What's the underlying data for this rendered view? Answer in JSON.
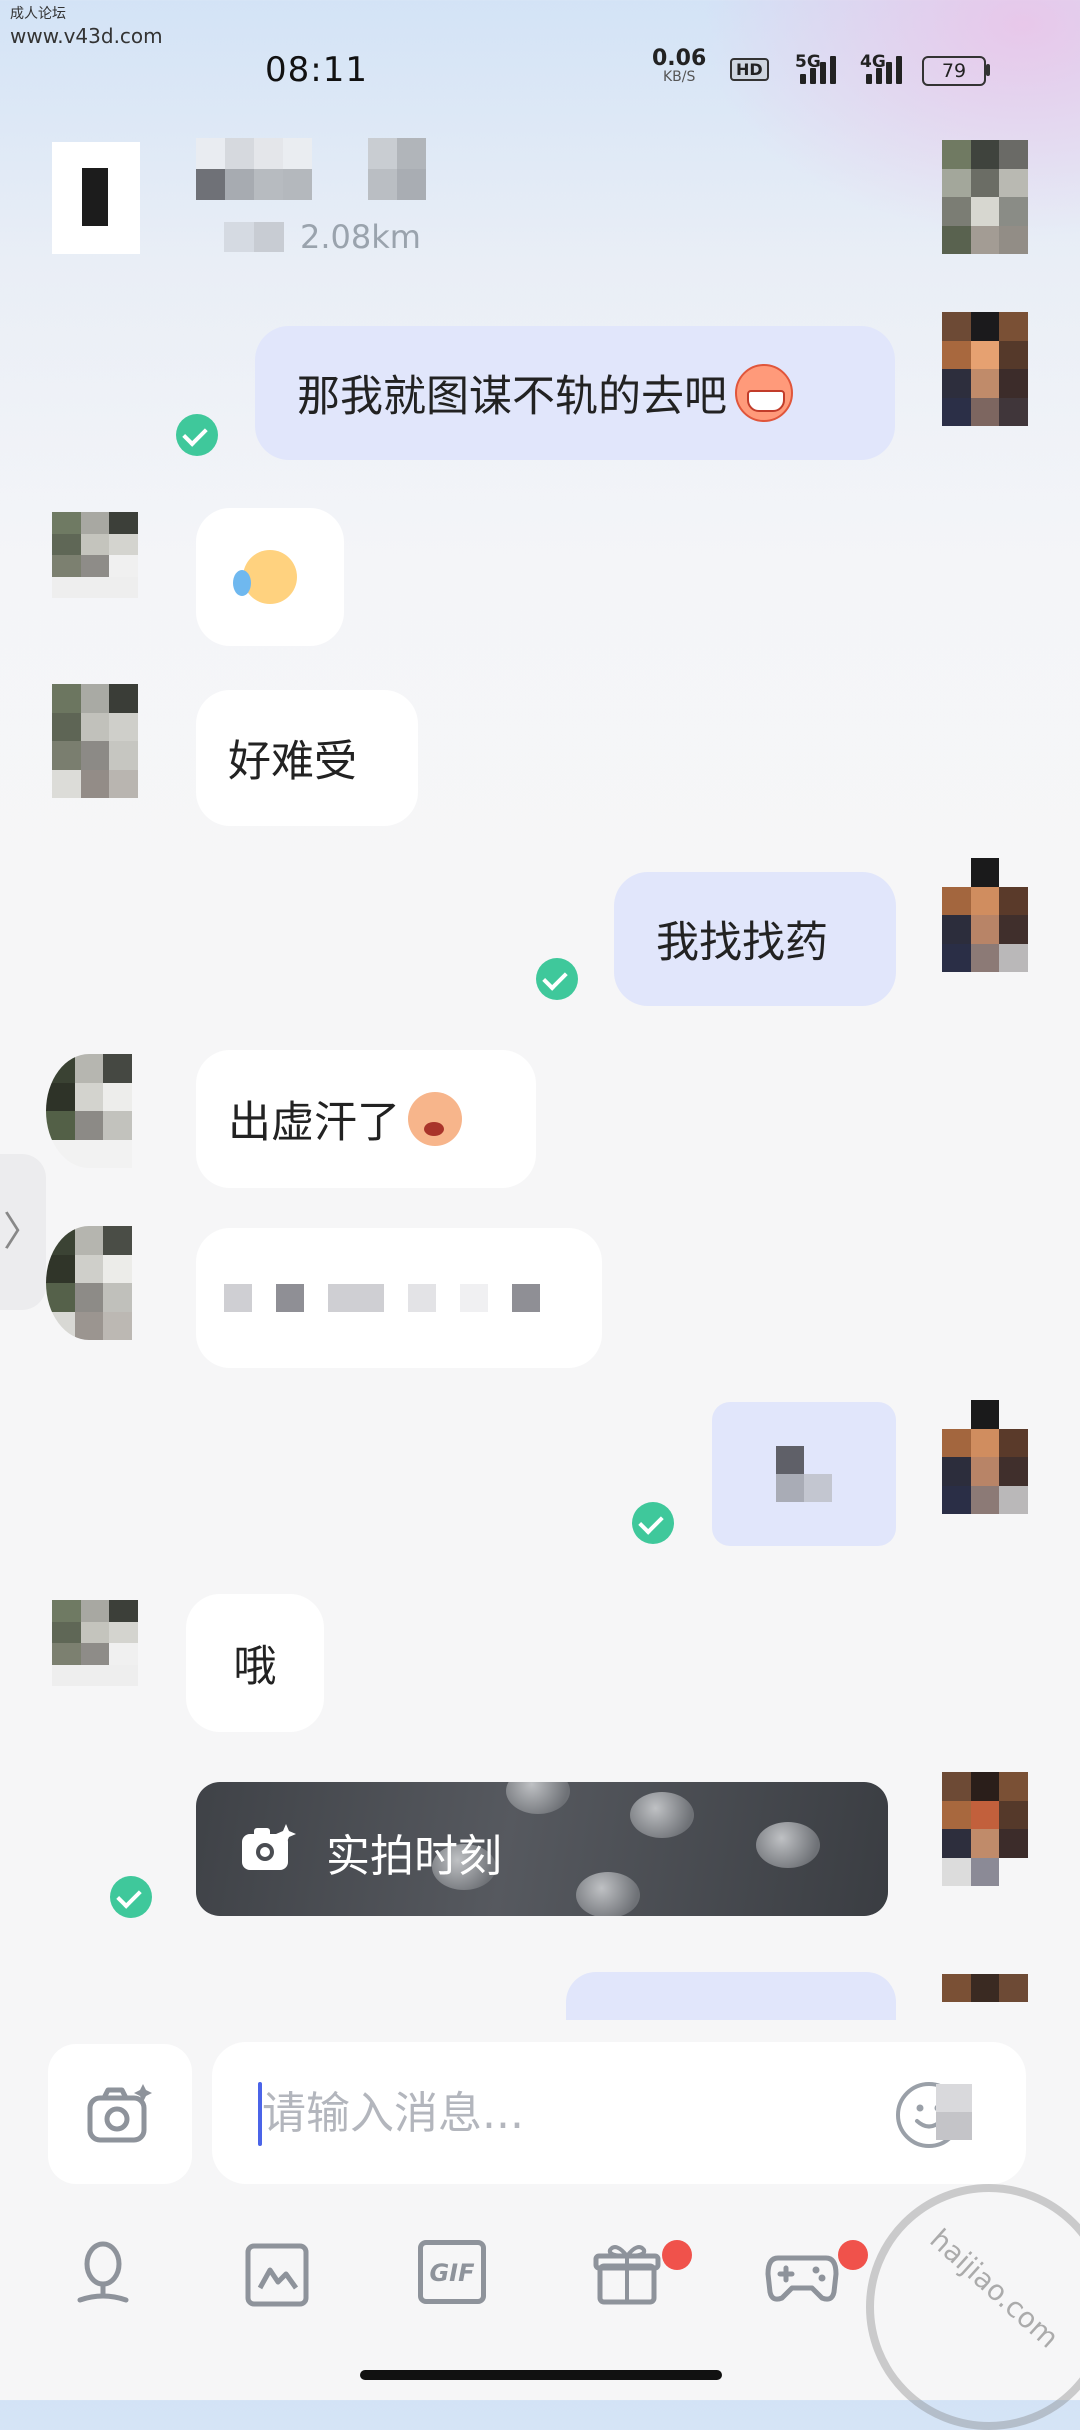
{
  "watermark": {
    "line1": "成人论坛",
    "line2": "www.v43d.com",
    "stamp_text": "haijiao.com"
  },
  "status_bar": {
    "time": "08:11",
    "net_speed": "0.06",
    "net_speed_unit": "KB/S",
    "hd_label": "HD",
    "network_1": "5G",
    "network_2": "4G",
    "battery": "79"
  },
  "header": {
    "distance": "2.08km"
  },
  "messages": [
    {
      "side": "out",
      "text": "那我就图谋不轨的去吧",
      "emoji": "grinning-pig-emoji"
    },
    {
      "side": "in",
      "text": "",
      "emoji": "crying-laughing-emoji"
    },
    {
      "side": "in",
      "text": "好难受"
    },
    {
      "side": "out",
      "text": "我找找药"
    },
    {
      "side": "in",
      "text": "出虚汗了",
      "emoji": "flushed-face-emoji"
    },
    {
      "side": "in",
      "text": "",
      "pixelated": true
    },
    {
      "side": "out",
      "text": "",
      "pixelated": true
    },
    {
      "side": "in",
      "text": "哦"
    },
    {
      "side": "out",
      "type": "moment-card",
      "text": "实拍时刻"
    }
  ],
  "input": {
    "placeholder": "请输入消息..."
  },
  "toolbar": {
    "items": [
      "microphone-icon",
      "image-icon",
      "gif-icon",
      "gift-icon",
      "game-controller-icon"
    ],
    "gif_label": "GIF",
    "side_tab_label": "〉"
  },
  "colors": {
    "outgoing_bubble": "#e1e6fb",
    "incoming_bubble": "#ffffff",
    "read_check": "#3fc89b",
    "badge": "#f0524b",
    "caret": "#4b64e8"
  }
}
